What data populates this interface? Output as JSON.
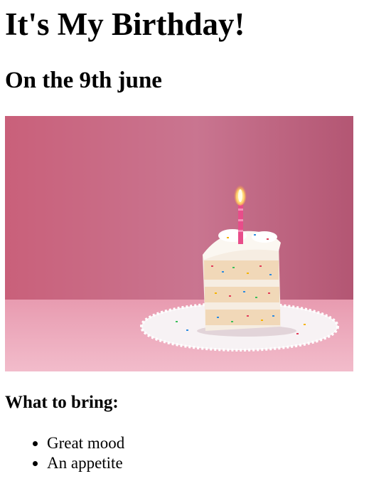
{
  "page": {
    "title": "It's My Birthday!",
    "subtitle": "On the 9th june",
    "bring_heading": "What to bring:",
    "bring_items": [
      "Great mood",
      "An appetite"
    ]
  },
  "colors": {
    "background_pink": "#c96f86",
    "table_pink": "#eeb4c2",
    "cake_cream": "#f6ede2",
    "candle_pink": "#e84d8a"
  }
}
